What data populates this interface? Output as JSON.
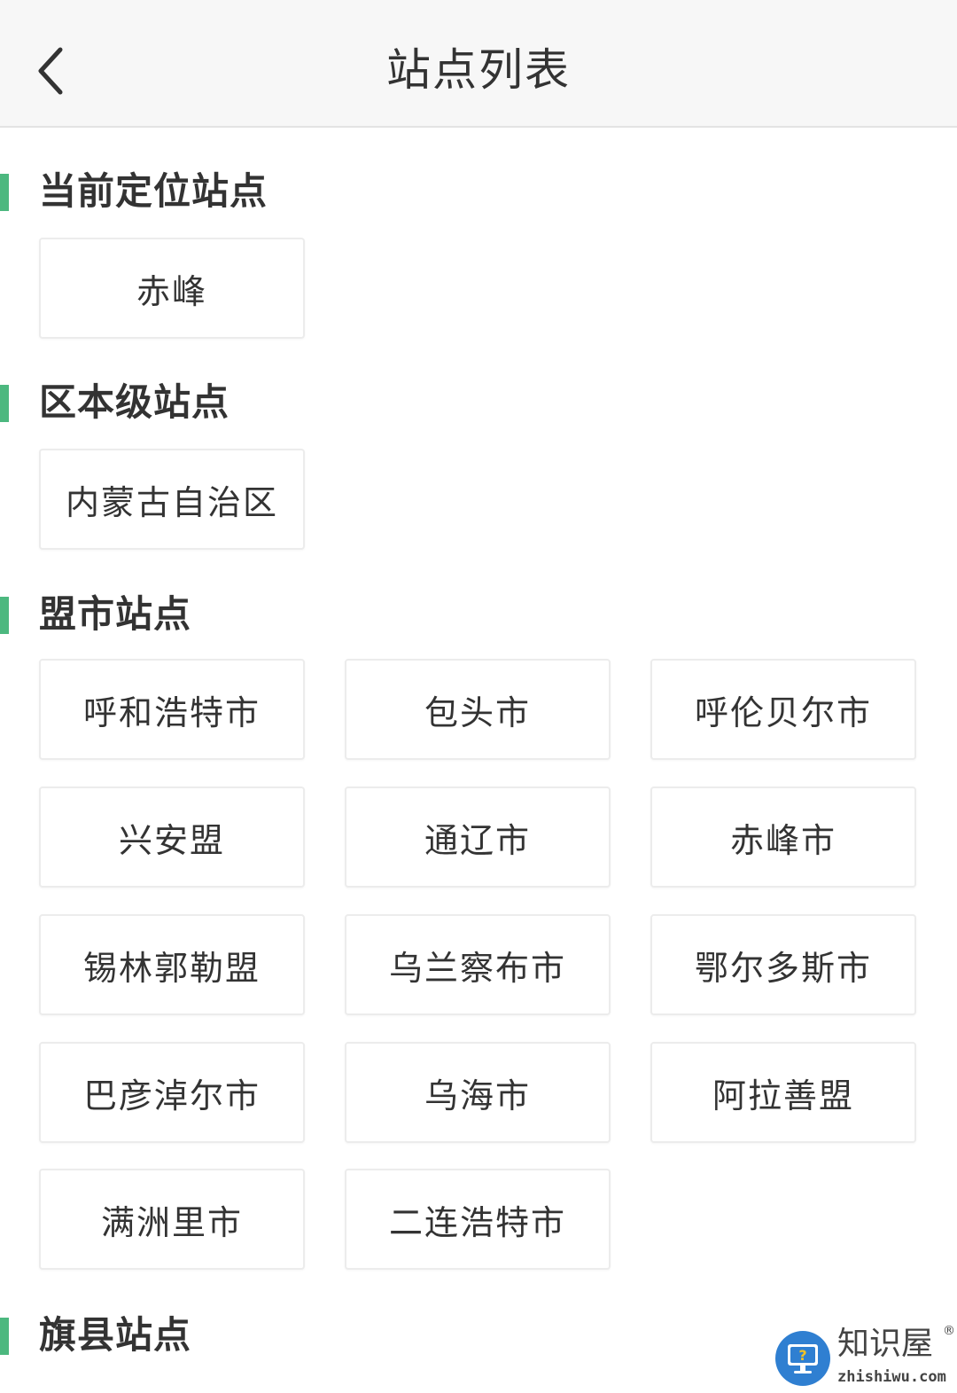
{
  "header": {
    "title": "站点列表"
  },
  "sections": {
    "current": {
      "title": "当前定位站点",
      "items": [
        "赤峰"
      ]
    },
    "region": {
      "title": "区本级站点",
      "items": [
        "内蒙古自治区"
      ]
    },
    "league_city": {
      "title": "盟市站点",
      "items": [
        "呼和浩特市",
        "包头市",
        "呼伦贝尔市",
        "兴安盟",
        "通辽市",
        "赤峰市",
        "锡林郭勒盟",
        "乌兰察布市",
        "鄂尔多斯市",
        "巴彦淖尔市",
        "乌海市",
        "阿拉善盟",
        "满洲里市",
        "二连浩特市"
      ]
    },
    "banner_county": {
      "title": "旗县站点"
    }
  },
  "watermark": {
    "name": "知识屋",
    "registered": "®",
    "domain": "zhishiwu.com"
  },
  "colors": {
    "accent": "#4cb87f",
    "header_bg": "#f7f7f7",
    "border": "#ececec",
    "text": "#333333"
  }
}
